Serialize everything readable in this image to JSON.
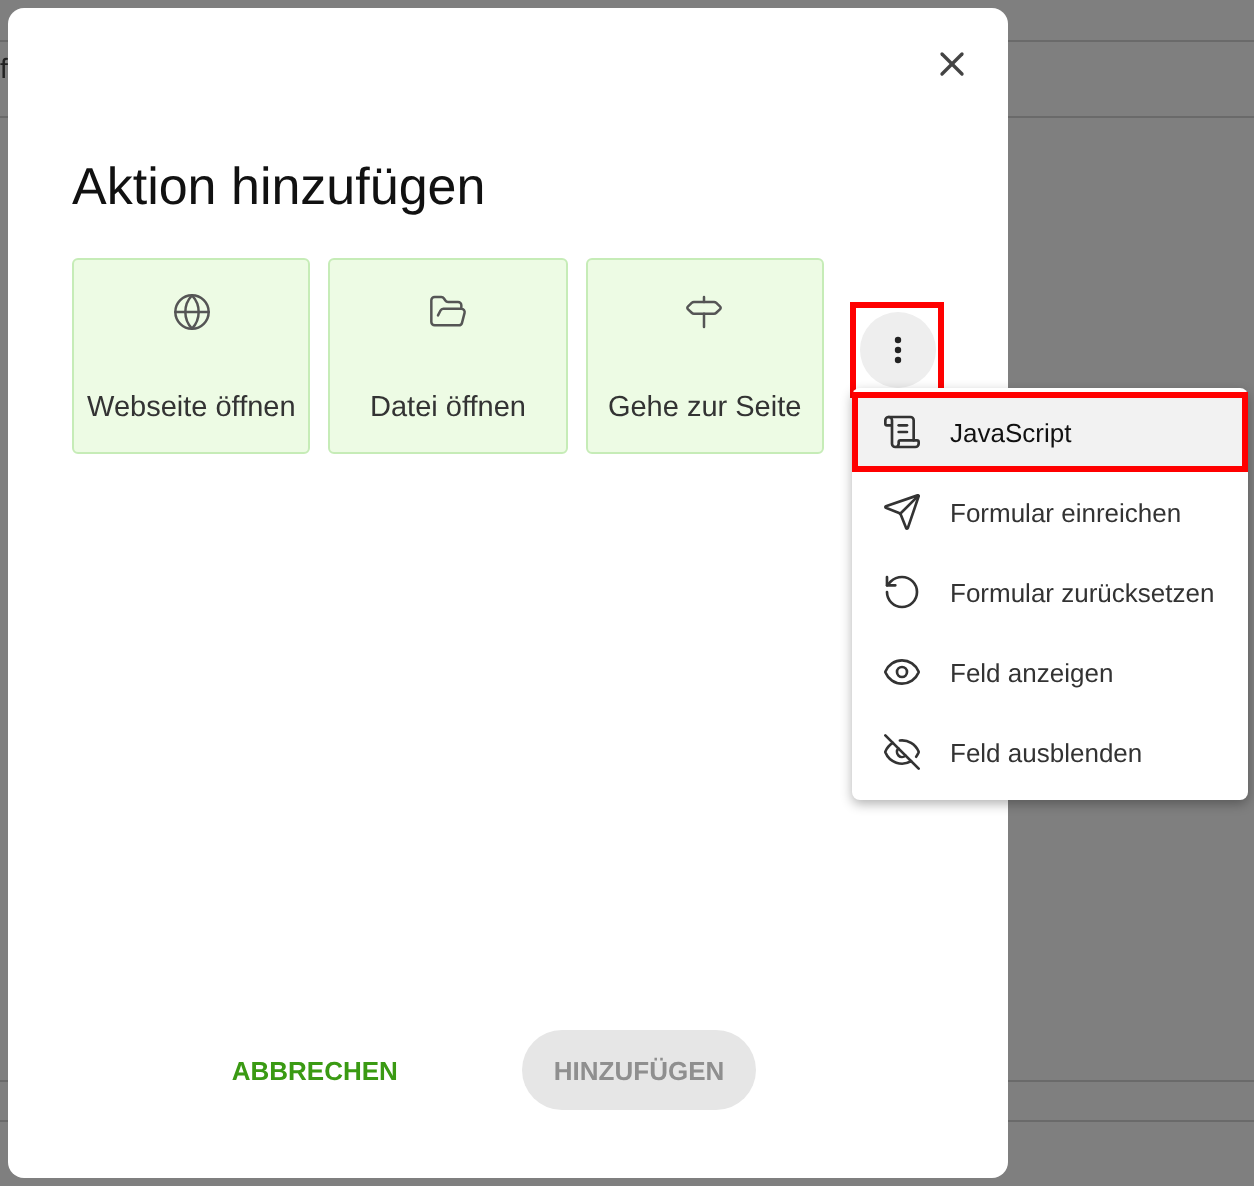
{
  "background": {
    "text": "f"
  },
  "dialog": {
    "title": "Aktion hinzufügen",
    "actions": [
      {
        "kind": "globe",
        "label": "Webseite öffnen"
      },
      {
        "kind": "folder",
        "label": "Datei öffnen"
      },
      {
        "kind": "signpost",
        "label": "Gehe zur Seite"
      }
    ],
    "more_button": {
      "highlighted": true
    },
    "buttons": [
      {
        "label": "ABBRECHEN",
        "disabled": false
      },
      {
        "label": "HINZUFÜGEN",
        "disabled": true
      }
    ]
  },
  "menu": {
    "items": [
      {
        "kind": "script",
        "label": "JavaScript",
        "selected": true,
        "highlighted": true
      },
      {
        "kind": "send",
        "label": "Formular einreichen",
        "selected": false,
        "highlighted": false
      },
      {
        "kind": "reset",
        "label": "Formular zurücksetzen",
        "selected": false,
        "highlighted": false
      },
      {
        "kind": "eye",
        "label": "Feld anzeigen",
        "selected": false,
        "highlighted": false
      },
      {
        "kind": "eyeoff",
        "label": "Feld ausblenden",
        "selected": false,
        "highlighted": false
      }
    ]
  }
}
